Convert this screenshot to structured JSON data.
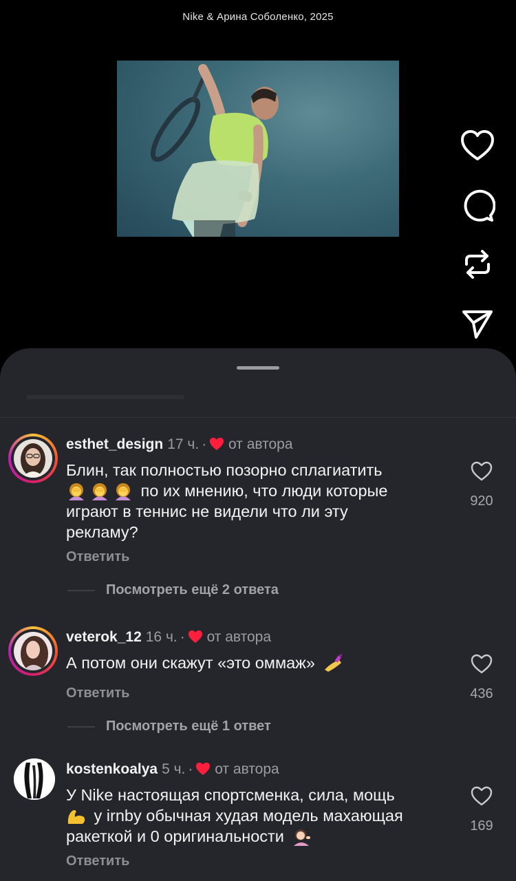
{
  "caption": "Nike & Арина Соболенко, 2025",
  "actions": [
    {
      "name": "like-icon"
    },
    {
      "name": "comment-icon"
    },
    {
      "name": "repost-icon"
    },
    {
      "name": "share-icon"
    }
  ],
  "colors": {
    "sheet_bg": "#25262b",
    "like_red": "#ff1f3d",
    "muted_text": "#9c9ca2"
  },
  "comments": [
    {
      "username": "esthet_design",
      "time": "17 ч.",
      "separator": "·",
      "author_label": "от автора",
      "text_line1": "Блин, так полностью позорно сплагиатить",
      "text_line2": "по их мнению, что люди которые",
      "text_line3": "играют в теннис не видели что ли эту",
      "text_line4": "рекламу?",
      "emojis": [
        "woman-facepalming-emoji",
        "woman-facepalming-emoji",
        "woman-facepalming-emoji"
      ],
      "likes": "920",
      "reply_label": "Ответить",
      "more_replies": "Посмотреть ещё 2 ответа"
    },
    {
      "username": "veterok_12",
      "time": "16 ч.",
      "separator": "·",
      "author_label": "от автора",
      "text": "А потом они скажут «это оммаж»",
      "emoji": "nail-polish-emoji",
      "likes": "436",
      "reply_label": "Ответить",
      "more_replies": "Посмотреть ещё 1 ответ"
    },
    {
      "username": "kostenkoalya",
      "time": "5 ч.",
      "separator": "·",
      "author_label": "от автора",
      "text_line1": "У Nike настоящая спортсменка, сила, мощь",
      "text_line2": "у irnby обычная худая модель махающая",
      "text_line3": "ракеткой и 0 оригинальности",
      "emoji_line2": "flexed-biceps-emoji",
      "emoji_line3": "woman-tipping-hand-emoji",
      "likes": "169",
      "reply_label": "Ответить"
    }
  ]
}
